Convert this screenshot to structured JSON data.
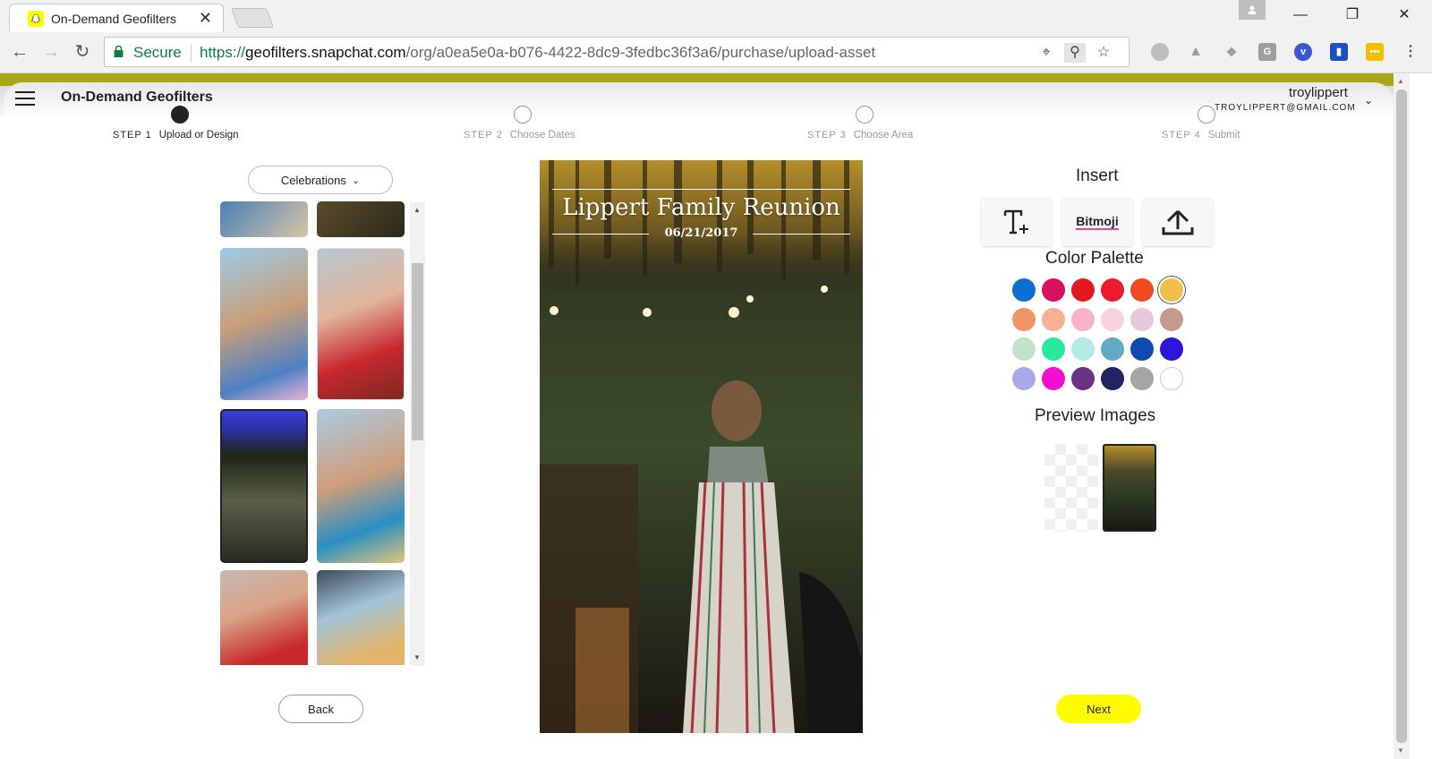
{
  "browser": {
    "tab_title": "On-Demand Geofilters",
    "tab_close": "✕",
    "secure_label": "Secure",
    "url_scheme": "https://",
    "url_host": "geofilters.snapchat.com",
    "url_path": "/org/a0ea5e0a-b076-4422-8dc9-3fedbc36f3a6/purchase/upload-asset"
  },
  "header": {
    "app_title": "On-Demand Geofilters",
    "username": "troylippert",
    "email": "TROYLIPPERT@GMAIL.COM"
  },
  "steps": [
    {
      "num": "STEP 1",
      "label": "Upload or Design"
    },
    {
      "num": "STEP 2",
      "label": "Choose Dates"
    },
    {
      "num": "STEP 3",
      "label": "Choose Area"
    },
    {
      "num": "STEP 4",
      "label": "Submit"
    }
  ],
  "gallery": {
    "category": "Celebrations"
  },
  "preview": {
    "title": "Lippert Family Reunion",
    "date": "06/21/2017"
  },
  "insert": {
    "heading": "Insert",
    "bitmoji_label": "Bitmoji"
  },
  "palette": {
    "heading": "Color Palette",
    "colors": [
      "#0a6fd1",
      "#d90f62",
      "#e3181f",
      "#ec1c2e",
      "#ee4b23",
      "#f2be4a",
      "#f2946a",
      "#f9b090",
      "#f6b3c3",
      "#f7d3e1",
      "#e6c8dd",
      "#c59b8b",
      "#c3e2cc",
      "#2ae89c",
      "#b2ebe3",
      "#62a9c3",
      "#0d4bb0",
      "#2b16d9",
      "#a9a8ea",
      "#f20fd0",
      "#6a3282",
      "#232263",
      "#a5a5a5",
      "#ffffff"
    ]
  },
  "preview_images": {
    "heading": "Preview Images"
  },
  "buttons": {
    "back": "Back",
    "next": "Next"
  }
}
